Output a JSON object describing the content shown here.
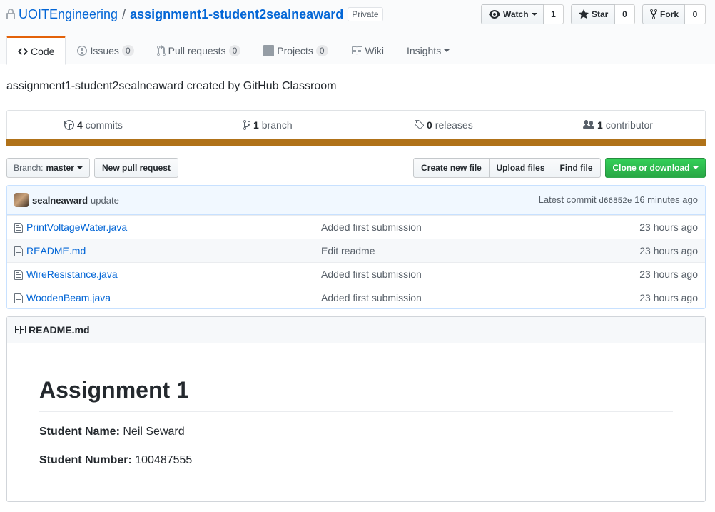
{
  "repo": {
    "owner": "UOITEngineering",
    "separator": "/",
    "name": "assignment1-student2sealneaward",
    "visibility": "Private"
  },
  "social": {
    "watch_label": "Watch",
    "watch_count": "1",
    "star_label": "Star",
    "star_count": "0",
    "fork_label": "Fork",
    "fork_count": "0"
  },
  "tabs": [
    {
      "label": "Code",
      "counter": null,
      "selected": true
    },
    {
      "label": "Issues",
      "counter": "0"
    },
    {
      "label": "Pull requests",
      "counter": "0"
    },
    {
      "label": "Projects",
      "counter": "0"
    },
    {
      "label": "Wiki",
      "counter": null
    },
    {
      "label": "Insights",
      "counter": null
    }
  ],
  "description": "assignment1-student2sealneaward created by GitHub Classroom",
  "summary": {
    "commits_count": "4",
    "commits_label": "commits",
    "branch_count": "1",
    "branch_label": "branch",
    "releases_count": "0",
    "releases_label": "releases",
    "contributor_count": "1",
    "contributor_label": "contributor",
    "language_color": "#b07219"
  },
  "file_nav": {
    "branch_prefix": "Branch:",
    "branch_name": "master",
    "new_pr": "New pull request",
    "create_file": "Create new file",
    "upload_files": "Upload files",
    "find_file": "Find file",
    "clone": "Clone or download"
  },
  "latest_commit": {
    "author": "sealneaward",
    "message": "update",
    "prefix": "Latest commit",
    "sha": "d66852e",
    "age": "16 minutes ago"
  },
  "files": [
    {
      "name": "PrintVoltageWater.java",
      "message": "Added first submission",
      "age": "23 hours ago"
    },
    {
      "name": "README.md",
      "message": "Edit readme",
      "age": "23 hours ago"
    },
    {
      "name": "WireResistance.java",
      "message": "Added first submission",
      "age": "23 hours ago"
    },
    {
      "name": "WoodenBeam.java",
      "message": "Added first submission",
      "age": "23 hours ago"
    }
  ],
  "readme": {
    "filename": "README.md",
    "heading": "Assignment 1",
    "name_label": "Student Name:",
    "name_value": "Neil Seward",
    "number_label": "Student Number:",
    "number_value": "100487555"
  }
}
